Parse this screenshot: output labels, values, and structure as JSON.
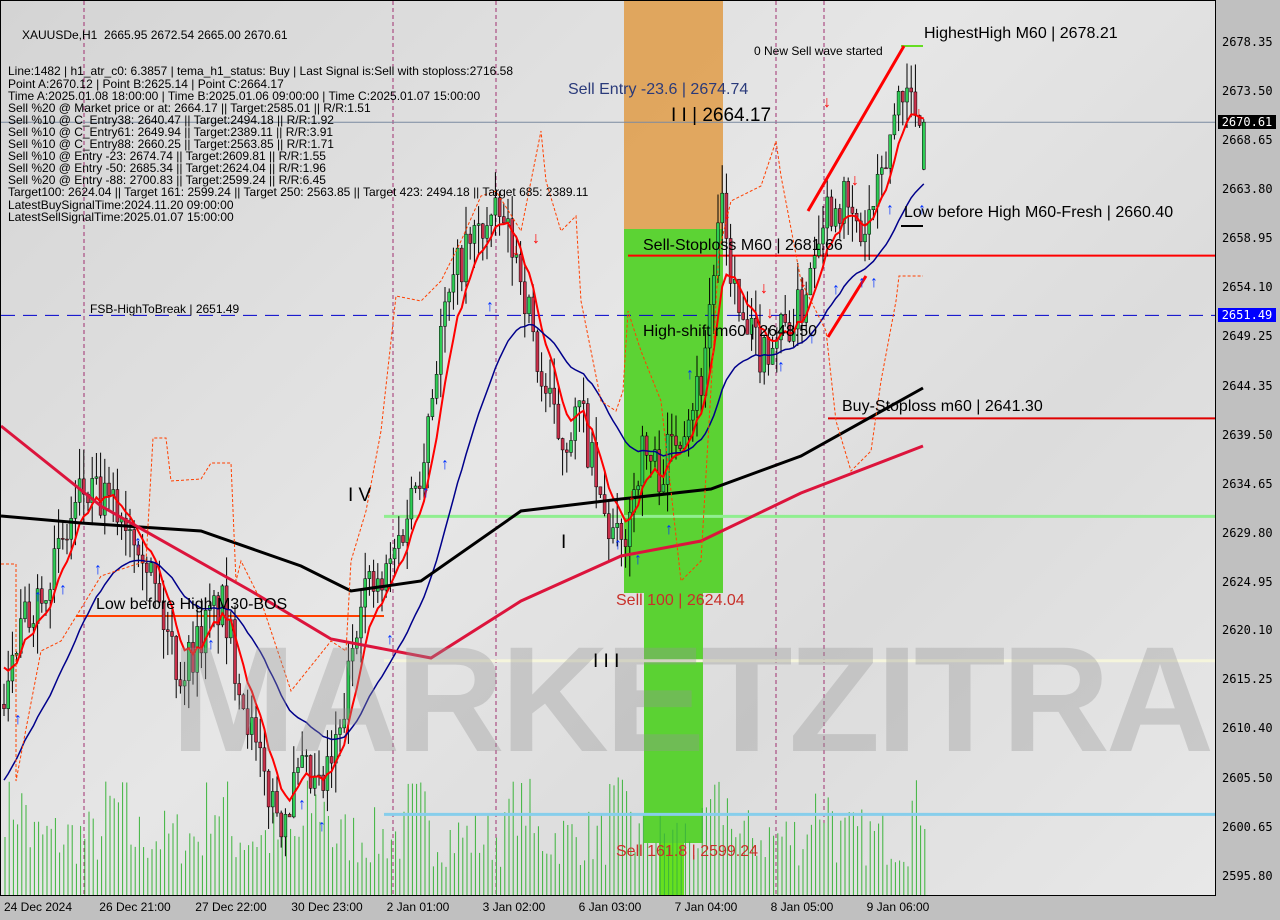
{
  "header": {
    "symbol_line": "XAUUSDe,H1  2665.95 2672.54 2665.00 2670.61",
    "info_lines": [
      "Line:1482 | h1_atr_c0: 6.3857 | tema_h1_status: Buy | Last Signal is:Sell with stoploss:2716.58",
      "Point A:2670.12 | Point B:2625.14 | Point C:2664.17",
      "Time A:2025.01.08 18:00:00 | Time B:2025.01.06 09:00:00 | Time C:2025.01.07 15:00:00",
      "Sell %20 @ Market price or at: 2664.17 || Target:2585.01 || R/R:1.51",
      "Sell %10 @ C_Entry38: 2640.47 || Target:2494.18 || R/R:1.92",
      "Sell %10 @ C_Entry61: 2649.94 || Target:2389.11 || R/R:3.91",
      "Sell %10 @ C_Entry88: 2660.25 || Target:2563.85 || R/R:1.71",
      "Sell %10 @ Entry -23: 2674.74 || Target:2609.81 || R/R:1.55",
      "Sell %20 @ Entry -50: 2685.34 || Target:2624.04 || R/R:1.96",
      "Sell %20 @ Entry -88: 2700.83 || Target:2599.24 || R/R:6.45",
      "Target100: 2624.04 || Target 161: 2599.24 || Target 250: 2563.85 || Target 423: 2494.18 || Target 685: 2389.11",
      "LatestBuySignalTime:2024.11.20 09:00:00",
      "LatestSellSignalTime:2025.01.07 15:00:00"
    ]
  },
  "annotations": {
    "sell_entry": "Sell Entry -23.6 | 2674.74",
    "wave_c": "I I | 2664.17",
    "highest_high": "HighestHigh    M60 | 2678.21",
    "new_sell_wave": "0 New Sell wave started",
    "low_before_high_fresh": "Low before High    M60-Fresh | 2660.40",
    "sell_stoploss": "Sell-Stoploss M60 | 2681.66",
    "high_shift": "High-shift m60 | 2648.50",
    "fsb": "FSB-HighToBreak | 2651.49",
    "buy_stoploss": "Buy-Stoploss m60 | 2641.30",
    "wave_iv": "I V",
    "wave_i": "I",
    "wave_iii": "I I I",
    "low_before_high_bos": "Low before High  M30-BOS",
    "sell_100": "Sell 100 | 2624.04",
    "sell_161": "Sell 161.8 | 2599.24",
    "watermark": "MARKETZITRADE"
  },
  "price_tags": {
    "current": "2670.61",
    "fsb": "2651.49"
  },
  "colors": {
    "bull": "#2ecc55",
    "bear": "#c8304a",
    "ma_fast": "#ff0000",
    "ma_mid": "#00008b",
    "ma_slow": "#000000",
    "ma_red": "#dc143c",
    "volume": "#3cb43c",
    "sell_zone": "#e0a050",
    "target_zone": "#4cd020"
  },
  "chart_data": {
    "type": "candlestick",
    "symbol": "XAUUSDe",
    "timeframe": "H1",
    "ylim": [
      2593.5,
      2682.6
    ],
    "y_ticks": [
      "2678.35",
      "2673.50",
      "2668.65",
      "2663.80",
      "2658.95",
      "2654.10",
      "2649.25",
      "2644.35",
      "2639.50",
      "2634.65",
      "2629.80",
      "2624.95",
      "2620.10",
      "2615.25",
      "2610.40",
      "2605.50",
      "2600.65",
      "2595.80"
    ],
    "x_ticks": [
      "24 Dec 2024",
      "26 Dec 21:00",
      "27 Dec 22:00",
      "30 Dec 23:00",
      "2 Jan 01:00",
      "3 Jan 02:00",
      "6 Jan 03:00",
      "7 Jan 04:00",
      "8 Jan 05:00",
      "9 Jan 06:00"
    ],
    "approx_price_path": [
      2613,
      2620,
      2625,
      2628,
      2634,
      2633,
      2632,
      2630,
      2622,
      2616,
      2620,
      2623,
      2615,
      2606,
      2602,
      2606,
      2604,
      2610,
      2625,
      2624,
      2630,
      2637,
      2650,
      2657,
      2660,
      2661,
      2656,
      2645,
      2639,
      2642,
      2632,
      2628,
      2638,
      2636,
      2641,
      2645,
      2662,
      2650,
      2648,
      2650,
      2652,
      2662,
      2663,
      2659,
      2664,
      2675,
      2670.61
    ],
    "last_ohlc": {
      "open": 2665.95,
      "high": 2672.54,
      "low": 2665.0,
      "close": 2670.61
    },
    "levels": {
      "current": 2670.61,
      "fsb_high_to_break": 2651.49,
      "sell_stoploss_line": 2657.4,
      "buy_stoploss": 2641.3,
      "green_level": 2631.6,
      "cream_level": 2617.3,
      "blue_level": 2602.1,
      "low_before_high_bos": 2617.5,
      "low_before_high_fresh": 2660.4,
      "highest_high": 2678.21
    }
  }
}
